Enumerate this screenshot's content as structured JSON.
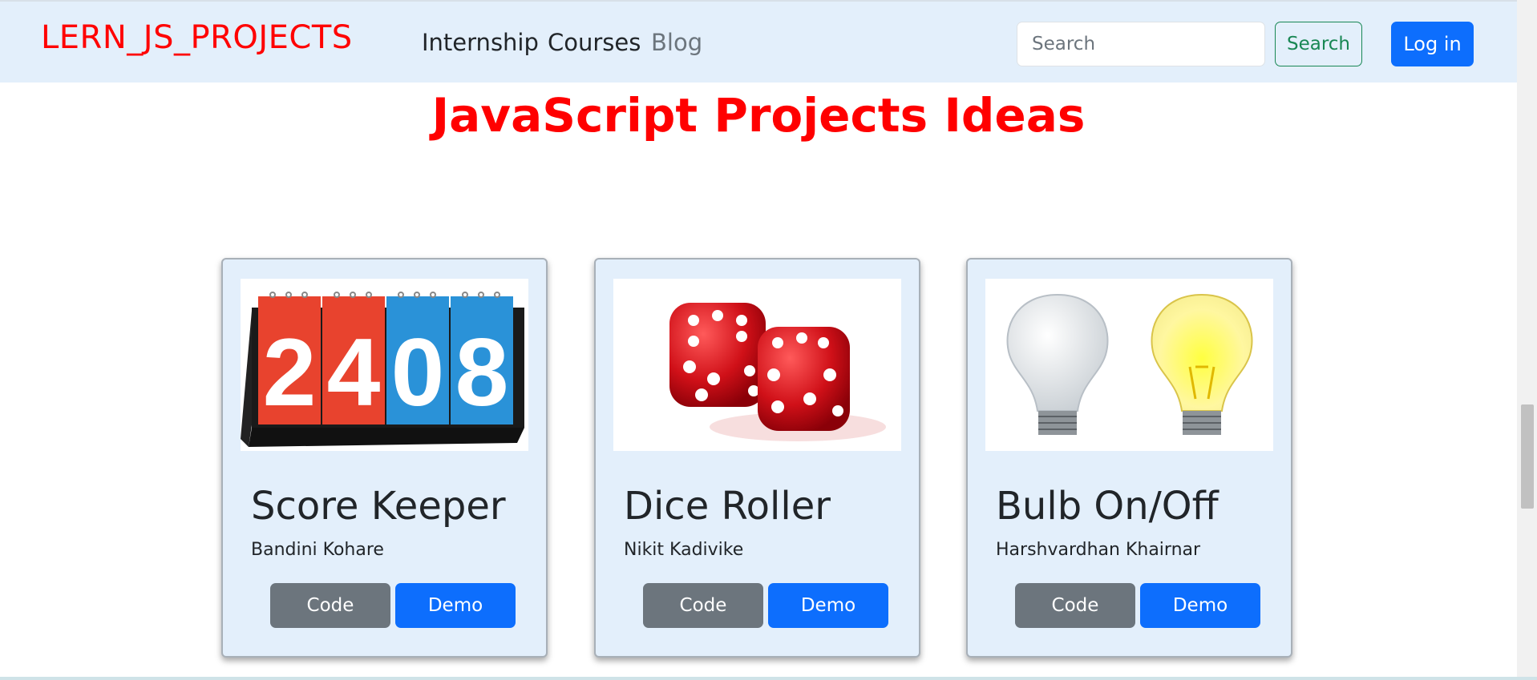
{
  "nav": {
    "brand": "LERN_JS_PROJECTS",
    "links": [
      {
        "label": "Internship"
      },
      {
        "label": "Courses"
      },
      {
        "label": "Blog"
      }
    ],
    "search_placeholder": "Search",
    "search_button": "Search",
    "login_button": "Log in"
  },
  "main": {
    "title": "JavaScript Projects Ideas",
    "cards": [
      {
        "title": "Score Keeper",
        "author": "Bandini Kohare",
        "code_label": "Code",
        "demo_label": "Demo",
        "image": "scoreboard-flip-card",
        "image_digits": [
          "2",
          "4",
          "0",
          "8"
        ]
      },
      {
        "title": "Dice Roller",
        "author": "Nikit Kadivike",
        "code_label": "Code",
        "demo_label": "Demo",
        "image": "red-dice-pair"
      },
      {
        "title": "Bulb On/Off",
        "author": "Harshvardhan Khairnar",
        "code_label": "Code",
        "demo_label": "Demo",
        "image": "light-bulbs-off-on"
      }
    ]
  },
  "colors": {
    "brand": "#ff0000",
    "navbar_bg": "#e3effb",
    "primary": "#0d6efd",
    "secondary": "#6c757d",
    "success": "#198754"
  }
}
